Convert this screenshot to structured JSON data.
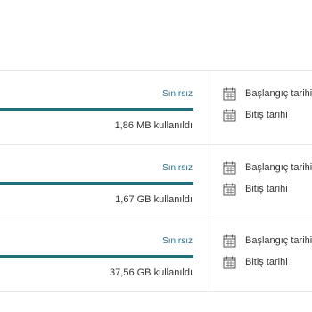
{
  "colors": {
    "accent": "#1e6f7d",
    "track": "#e3e3e3",
    "limit_text": "#2b6f8f",
    "text": "#333333"
  },
  "rows": [
    {
      "limit_label": "Sınırsız",
      "usage_label": "1,86 MB kullanıldı",
      "progress_fraction": 1.0,
      "start_date_label": "Başlangıç tarihi",
      "end_date_label": "Bitiş tarihi",
      "icon": "calendar-icon"
    },
    {
      "limit_label": "Sınırsız",
      "usage_label": "1,67 GB kullanıldı",
      "progress_fraction": 1.0,
      "start_date_label": "Başlangıç tarihi",
      "end_date_label": "Bitiş tarihi",
      "icon": "calendar-icon"
    },
    {
      "limit_label": "Sınırsız",
      "usage_label": "37,56 GB kullanıldı",
      "progress_fraction": 1.0,
      "start_date_label": "Başlangıç tarihi",
      "end_date_label": "Bitiş tarihi",
      "icon": "calendar-icon"
    }
  ]
}
